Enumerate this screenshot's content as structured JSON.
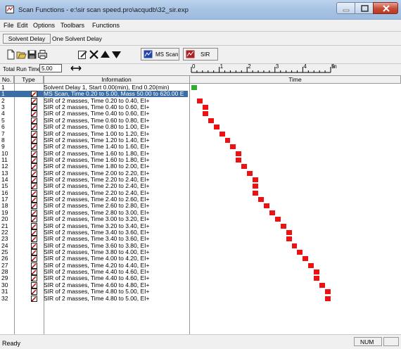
{
  "window": {
    "title": "Scan Functions - e:\\sir scan speed.pro\\acqudb\\32_sir.exp"
  },
  "menu": [
    "File",
    "Edit",
    "Options",
    "Toolbars",
    "Functions"
  ],
  "solvent": {
    "button_label": "Solvent Delay",
    "label": "One Solvent Delay"
  },
  "toolbar": {
    "icons": [
      "new-icon",
      "open-icon",
      "save-icon",
      "print-icon",
      "edit-function-icon",
      "delete-icon",
      "move-up-icon",
      "move-down-icon"
    ],
    "ms_scan_label": "MS Scan",
    "sir_label": "SIR"
  },
  "run": {
    "label": "Total Run Time:",
    "value": "5.00"
  },
  "ruler": {
    "ticks": [
      "0",
      "1",
      "2",
      "3",
      "4",
      "5"
    ],
    "unit": "m"
  },
  "table": {
    "headers": {
      "no": "No.",
      "type": "Type",
      "info": "Information",
      "time": "Time"
    },
    "time_max": 5.0,
    "rows": [
      {
        "no": "1",
        "type": "solvent",
        "info": "Solvent Delay 1, Start 0.00(min), End 0.20(min)",
        "start": 0.0,
        "end": 0.2,
        "color": "#33aa33"
      },
      {
        "no": "1",
        "type": "msscan",
        "info": "MS Scan, Time 0.20 to 5.00, Mass 50.00 to 620.00 E",
        "start": 0.2,
        "end": 5.0,
        "color": "#3a6ea5",
        "selected": true
      },
      {
        "no": "2",
        "type": "sir",
        "info": "SIR of 2 masses, Time 0.20 to 0.40, EI+",
        "start": 0.2,
        "end": 0.4,
        "color": "#ee1111"
      },
      {
        "no": "3",
        "type": "sir",
        "info": "SIR of 2 masses, Time 0.40 to 0.60, EI+",
        "start": 0.4,
        "end": 0.6,
        "color": "#ee1111"
      },
      {
        "no": "4",
        "type": "sir",
        "info": "SIR of 2 masses, Time 0.40 to 0.60, EI+",
        "start": 0.4,
        "end": 0.6,
        "color": "#ee1111"
      },
      {
        "no": "5",
        "type": "sir",
        "info": "SIR of 2 masses, Time 0.60 to 0.80, EI+",
        "start": 0.6,
        "end": 0.8,
        "color": "#ee1111"
      },
      {
        "no": "6",
        "type": "sir",
        "info": "SIR of 2 masses, Time 0.80 to 1.00, EI+",
        "start": 0.8,
        "end": 1.0,
        "color": "#ee1111"
      },
      {
        "no": "7",
        "type": "sir",
        "info": "SIR of 2 masses, Time 1.00 to 1.20, EI+",
        "start": 1.0,
        "end": 1.2,
        "color": "#ee1111"
      },
      {
        "no": "8",
        "type": "sir",
        "info": "SIR of 2 masses, Time 1.20 to 1.40, EI+",
        "start": 1.2,
        "end": 1.4,
        "color": "#ee1111"
      },
      {
        "no": "9",
        "type": "sir",
        "info": "SIR of 2 masses, Time 1.40 to 1.60, EI+",
        "start": 1.4,
        "end": 1.6,
        "color": "#ee1111"
      },
      {
        "no": "10",
        "type": "sir",
        "info": "SIR of 2 masses, Time 1.60 to 1.80, EI+",
        "start": 1.6,
        "end": 1.8,
        "color": "#ee1111"
      },
      {
        "no": "11",
        "type": "sir",
        "info": "SIR of 2 masses, Time 1.60 to 1.80, EI+",
        "start": 1.6,
        "end": 1.8,
        "color": "#ee1111"
      },
      {
        "no": "12",
        "type": "sir",
        "info": "SIR of 2 masses, Time 1.80 to 2.00, EI+",
        "start": 1.8,
        "end": 2.0,
        "color": "#ee1111"
      },
      {
        "no": "13",
        "type": "sir",
        "info": "SIR of 2 masses, Time 2.00 to 2.20, EI+",
        "start": 2.0,
        "end": 2.2,
        "color": "#ee1111"
      },
      {
        "no": "14",
        "type": "sir",
        "info": "SIR of 2 masses, Time 2.20 to 2.40, EI+",
        "start": 2.2,
        "end": 2.4,
        "color": "#ee1111"
      },
      {
        "no": "15",
        "type": "sir",
        "info": "SIR of 2 masses, Time 2.20 to 2.40, EI+",
        "start": 2.2,
        "end": 2.4,
        "color": "#ee1111"
      },
      {
        "no": "16",
        "type": "sir",
        "info": "SIR of 2 masses, Time 2.20 to 2.40, EI+",
        "start": 2.2,
        "end": 2.4,
        "color": "#ee1111"
      },
      {
        "no": "17",
        "type": "sir",
        "info": "SIR of 2 masses, Time 2.40 to 2.60, EI+",
        "start": 2.4,
        "end": 2.6,
        "color": "#ee1111"
      },
      {
        "no": "18",
        "type": "sir",
        "info": "SIR of 2 masses, Time 2.60 to 2.80, EI+",
        "start": 2.6,
        "end": 2.8,
        "color": "#ee1111"
      },
      {
        "no": "19",
        "type": "sir",
        "info": "SIR of 2 masses, Time 2.80 to 3.00, EI+",
        "start": 2.8,
        "end": 3.0,
        "color": "#ee1111"
      },
      {
        "no": "20",
        "type": "sir",
        "info": "SIR of 2 masses, Time 3.00 to 3.20, EI+",
        "start": 3.0,
        "end": 3.2,
        "color": "#ee1111"
      },
      {
        "no": "21",
        "type": "sir",
        "info": "SIR of 2 masses, Time 3.20 to 3.40, EI+",
        "start": 3.2,
        "end": 3.4,
        "color": "#ee1111"
      },
      {
        "no": "22",
        "type": "sir",
        "info": "SIR of 2 masses, Time 3.40 to 3.60, EI+",
        "start": 3.4,
        "end": 3.6,
        "color": "#ee1111"
      },
      {
        "no": "23",
        "type": "sir",
        "info": "SIR of 2 masses, Time 3.40 to 3.60, EI+",
        "start": 3.4,
        "end": 3.6,
        "color": "#ee1111"
      },
      {
        "no": "24",
        "type": "sir",
        "info": "SIR of 2 masses, Time 3.60 to 3.80, EI+",
        "start": 3.6,
        "end": 3.8,
        "color": "#ee1111"
      },
      {
        "no": "25",
        "type": "sir",
        "info": "SIR of 2 masses, Time 3.80 to 4.00, EI+",
        "start": 3.8,
        "end": 4.0,
        "color": "#ee1111"
      },
      {
        "no": "26",
        "type": "sir",
        "info": "SIR of 2 masses, Time 4.00 to 4.20, EI+",
        "start": 4.0,
        "end": 4.2,
        "color": "#ee1111"
      },
      {
        "no": "27",
        "type": "sir",
        "info": "SIR of 2 masses, Time 4.20 to 4.40, EI+",
        "start": 4.2,
        "end": 4.4,
        "color": "#ee1111"
      },
      {
        "no": "28",
        "type": "sir",
        "info": "SIR of 2 masses, Time 4.40 to 4.60, EI+",
        "start": 4.4,
        "end": 4.6,
        "color": "#ee1111"
      },
      {
        "no": "29",
        "type": "sir",
        "info": "SIR of 2 masses, Time 4.40 to 4.60, EI+",
        "start": 4.4,
        "end": 4.6,
        "color": "#ee1111"
      },
      {
        "no": "30",
        "type": "sir",
        "info": "SIR of 2 masses, Time 4.60 to 4.80, EI+",
        "start": 4.6,
        "end": 4.8,
        "color": "#ee1111"
      },
      {
        "no": "31",
        "type": "sir",
        "info": "SIR of 2 masses, Time 4.80 to 5.00, EI+",
        "start": 4.8,
        "end": 5.0,
        "color": "#ee1111"
      },
      {
        "no": "32",
        "type": "sir",
        "info": "SIR of 2 masses, Time 4.80 to 5.00, EI+",
        "start": 4.8,
        "end": 5.0,
        "color": "#ee1111"
      }
    ]
  },
  "status": {
    "text": "Ready",
    "num": "NUM"
  }
}
